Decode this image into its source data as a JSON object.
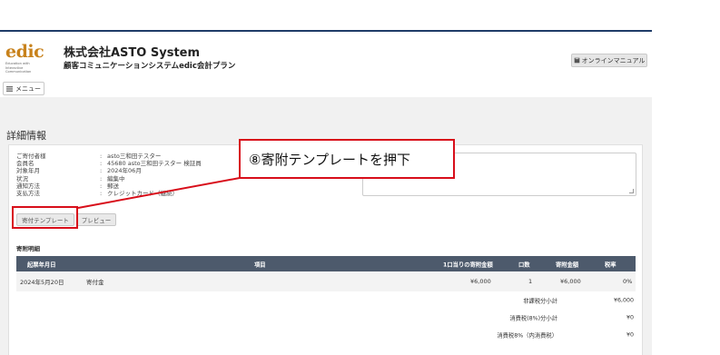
{
  "header": {
    "logo_word": "edic",
    "logo_tagline": [
      "Education with",
      "Interactive",
      "Communication"
    ],
    "company": "株式会社ASTO System",
    "system_name": "顧客コミュニケーションシステムedic会計プラン",
    "manual_button": "オンラインマニュアル",
    "manual_icon": "book-icon",
    "menu_button": "メニュー",
    "menu_icon": "hamburger-icon"
  },
  "page": {
    "title": "詳細情報"
  },
  "info": [
    {
      "label": "ご寄付者様",
      "value": "asto三和田テスター"
    },
    {
      "label": "会員名",
      "value": "45680 asto三和田テスター 検証員"
    },
    {
      "label": "対象年月",
      "value": "2024年06月"
    },
    {
      "label": "状況",
      "value": "編集中"
    },
    {
      "label": "通知方法",
      "value": "郵送"
    },
    {
      "label": "支払方法",
      "value": "クレジットカード（継続）"
    }
  ],
  "buttons": {
    "template": "寄付テンプレート",
    "preview": "プレビュー"
  },
  "detail_section": {
    "title": "寄附明細",
    "columns": [
      "起票年月日",
      "項目",
      "1口当りの寄附金額",
      "口数",
      "寄附金額",
      "税率"
    ],
    "rows": [
      {
        "date": "2024年5月20日",
        "item": "寄付金",
        "unit_amount": "¥6,000",
        "count": "1",
        "amount": "¥6,000",
        "tax_rate": "0%"
      }
    ],
    "summary": [
      {
        "label": "非課税分小計",
        "value": "¥6,000"
      },
      {
        "label": "消費税(8%)分小計",
        "value": "¥0"
      },
      {
        "label": "消費税8%（内消費税）",
        "value": "¥0"
      }
    ]
  },
  "annotation": {
    "text": "⑧寄附テンプレートを押下",
    "color": "#d80e1a"
  },
  "colors": {
    "header_rule": "#1f3c68",
    "table_header": "#4d5a6c",
    "logo": "#c8821c"
  }
}
